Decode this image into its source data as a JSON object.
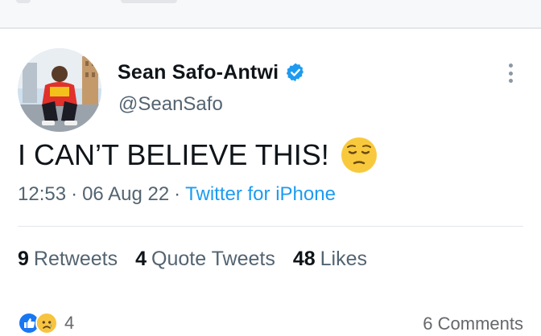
{
  "tweet": {
    "author": {
      "display_name": "Sean Safo-Antwi",
      "handle": "@SeanSafo",
      "verified": true
    },
    "text": "I CAN’T BELIEVE THIS!",
    "emoji": "pensive-face",
    "time": "12:53",
    "date": "06 Aug 22",
    "separator": "·",
    "source": "Twitter for iPhone",
    "stats": {
      "retweets_count": "9",
      "retweets_label": "Retweets",
      "quote_tweets_count": "4",
      "quote_tweets_label": "Quote Tweets",
      "likes_count": "48",
      "likes_label": "Likes"
    }
  },
  "facebook_footer": {
    "reaction_icons": [
      "like-icon",
      "sad-icon"
    ],
    "reaction_count": "4",
    "comments": "6 Comments"
  },
  "colors": {
    "accent": "#1d9bf0",
    "secondary_text": "#536471",
    "primary_text": "#0f1419"
  }
}
